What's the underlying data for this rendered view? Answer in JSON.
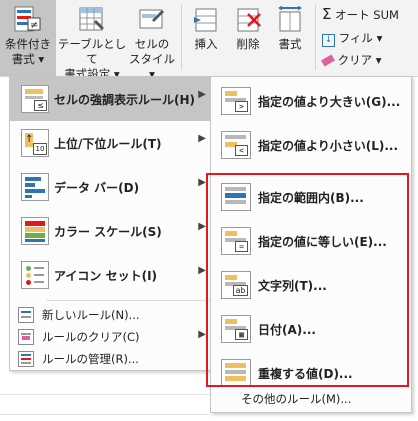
{
  "ribbon": {
    "conditional_format": "条件付き\n書式 ▾",
    "conditional_format_l1": "条件付き",
    "conditional_format_l2": "書式 ▾",
    "format_as_table_l1": "テーブルとして",
    "format_as_table_l2": "書式設定 ▾",
    "cell_styles_l1": "セルの",
    "cell_styles_l2": "スタイル ▾",
    "insert": "挿入",
    "delete": "削除",
    "format": "書式",
    "autosum": "オート SUM",
    "fill": "フィル ▾",
    "clear": "クリア ▾",
    "accent_colors": {
      "orange": "#f0c060",
      "red": "#e8151b",
      "blue": "#2e75b6"
    }
  },
  "menu": {
    "items": [
      {
        "label": "セルの強調表示ルール(H)",
        "icon": "highlight-rules-icon",
        "has_submenu": true,
        "selected": true
      },
      {
        "label": "上位/下位ルール(T)",
        "icon": "top-bottom-icon",
        "has_submenu": true
      },
      {
        "label": "データ バー(D)",
        "icon": "data-bar-icon",
        "has_submenu": true
      },
      {
        "label": "カラー スケール(S)",
        "icon": "color-scale-icon",
        "has_submenu": true
      },
      {
        "label": "アイコン セット(I)",
        "icon": "icon-set-icon",
        "has_submenu": true
      }
    ],
    "small_items": [
      {
        "label": "新しいルール(N)...",
        "icon": "new-rule-icon"
      },
      {
        "label": "ルールのクリア(C)",
        "icon": "clear-rules-icon",
        "has_submenu": true
      },
      {
        "label": "ルールの管理(R)...",
        "icon": "manage-rules-icon"
      }
    ],
    "icon_top_bottom_text": "10",
    "arrow": "▶"
  },
  "submenu": {
    "items": [
      {
        "label": "指定の値より大きい(G)...",
        "symbol": ">"
      },
      {
        "label": "指定の値より小さい(L)...",
        "symbol": "<"
      },
      {
        "label": "指定の範囲内(B)...",
        "symbol": ""
      },
      {
        "label": "指定の値に等しい(E)...",
        "symbol": "="
      },
      {
        "label": "文字列(T)...",
        "symbol": "ab"
      },
      {
        "label": "日付(A)...",
        "symbol": "cal"
      },
      {
        "label": "重複する値(D)...",
        "symbol": ""
      }
    ],
    "more_rules": "その他のルール(M)..."
  }
}
